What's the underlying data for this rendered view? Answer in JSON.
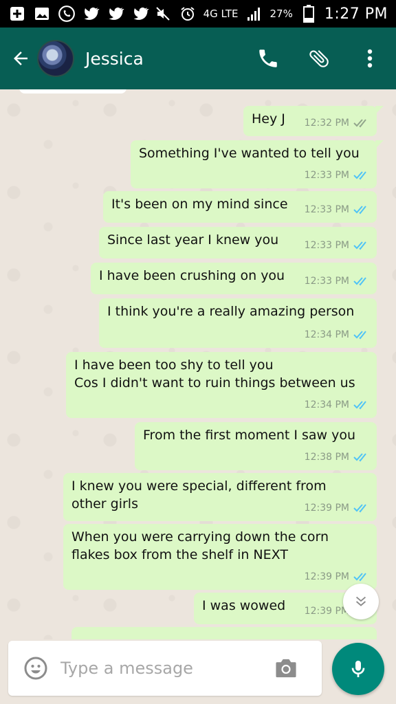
{
  "status_bar": {
    "battery": "27%",
    "network": "4G LTE",
    "time": "1:27 PM",
    "icons_left": [
      "plus-box-icon",
      "image-icon",
      "whatsapp-icon",
      "twitter-icon",
      "twitter-icon",
      "twitter-icon"
    ],
    "icons_right": [
      "mute-icon",
      "alarm-icon",
      "signal-icon",
      "battery-icon"
    ]
  },
  "header": {
    "contact_name": "Jessica",
    "back_icon": "arrow-left-icon",
    "actions": [
      "phone-icon",
      "attach-icon",
      "more-vert-icon"
    ],
    "color": "#075e54"
  },
  "messages": [
    {
      "text": "Hey J",
      "time": "12:32 PM",
      "status": "delivered"
    },
    {
      "text": "Something I've wanted to tell you",
      "time": "12:33 PM",
      "status": "read"
    },
    {
      "text": "It's been on my mind since",
      "time": "12:33 PM",
      "status": "read"
    },
    {
      "text": "Since last year I knew you",
      "time": "12:33 PM",
      "status": "read"
    },
    {
      "text": "I have been crushing on you",
      "time": "12:33 PM",
      "status": "read"
    },
    {
      "text": "I think you're a really amazing person",
      "time": "12:34 PM",
      "status": "read"
    },
    {
      "text": "I have been too shy to tell you\nCos I didn't want to ruin things between us",
      "time": "12:34 PM",
      "status": "read"
    },
    {
      "text": "From the first moment I saw you",
      "time": "12:38 PM",
      "status": "read"
    },
    {
      "text": "I knew you were special, different from\nother girls",
      "time": "12:39 PM",
      "status": "read"
    },
    {
      "text": "When you were carrying down the corn\nflakes box from the shelf in NEXT",
      "time": "12:39 PM",
      "status": "read"
    },
    {
      "text": "I was wowed",
      "time": "12:39 PM",
      "status": "read"
    }
  ],
  "compose": {
    "placeholder": "Type a message",
    "emoji_icon": "emoji-icon",
    "camera_icon": "camera-icon",
    "mic_icon": "mic-icon"
  },
  "colors": {
    "outgoing_bubble": "#dcf8c6",
    "read_tick": "#4fc3f7",
    "delivered_tick": "#92a58c",
    "fab": "#00897b"
  }
}
